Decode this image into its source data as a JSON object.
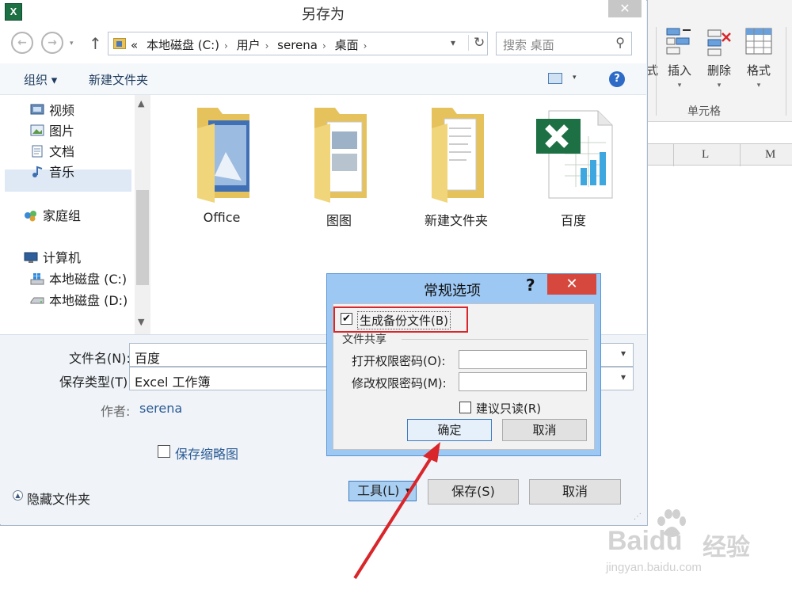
{
  "dialog": {
    "title": "另存为",
    "app_icon_text": "X",
    "close_glyph": "✕",
    "breadcrumb": [
      "«",
      "本地磁盘 (C:)",
      "用户",
      "serena",
      "桌面"
    ],
    "breadcrumb_sep": "›",
    "search_placeholder": "搜索 桌面",
    "toolbar": {
      "organize": "组织 ▾",
      "new_folder": "新建文件夹",
      "help": "?"
    },
    "sidebar": [
      {
        "label": "视频",
        "icon": "video-icon"
      },
      {
        "label": "图片",
        "icon": "pictures-icon"
      },
      {
        "label": "文档",
        "icon": "documents-icon"
      },
      {
        "label": "音乐",
        "icon": "music-icon"
      },
      {
        "label": "家庭组",
        "icon": "homegroup-icon"
      },
      {
        "label": "计算机",
        "icon": "computer-icon"
      },
      {
        "label": "本地磁盘 (C:)",
        "icon": "windows-drive-icon"
      },
      {
        "label": "本地磁盘 (D:)",
        "icon": "drive-icon"
      }
    ],
    "files": [
      {
        "name": "Office",
        "icon": "folder-icon"
      },
      {
        "name": "图图",
        "icon": "folder-icon"
      },
      {
        "name": "新建文件夹",
        "icon": "folder-icon"
      },
      {
        "name": "百度",
        "icon": "excel-file-icon"
      }
    ],
    "form": {
      "filename_label": "文件名(N):",
      "filename_value": "百度",
      "filetype_label": "保存类型(T):",
      "filetype_value": "Excel 工作簿",
      "author_label": "作者:",
      "author_value": "serena",
      "thumbnail_label": "保存缩略图",
      "hide_folders_label": "隐藏文件夹",
      "tools_label": "工具(L)",
      "save_label": "保存(S)",
      "cancel_label": "取消"
    }
  },
  "general_options": {
    "title": "常规选项",
    "help": "?",
    "close_glyph": "✕",
    "backup_label": "生成备份文件(B)",
    "backup_checked": true,
    "check_glyph": "✔",
    "sharing_group": "文件共享",
    "open_pwd_label": "打开权限密码(O):",
    "modify_pwd_label": "修改权限密码(M):",
    "readonly_label": "建议只读(R)",
    "readonly_checked": false,
    "ok_label": "确定",
    "cancel_label": "取消"
  },
  "excel": {
    "ribbon_buttons": [
      "插入",
      "删除",
      "格式"
    ],
    "ribbon_partial": "式",
    "group_label": "单元格",
    "columns": [
      "L",
      "M"
    ]
  },
  "watermark": {
    "brand": "Bai",
    "brand_suffix": "du",
    "cn": "经验",
    "url": "jingyan.baidu.com"
  },
  "colors": {
    "highlight_red": "#d8262b",
    "accent_blue": "#3d7bc1"
  }
}
